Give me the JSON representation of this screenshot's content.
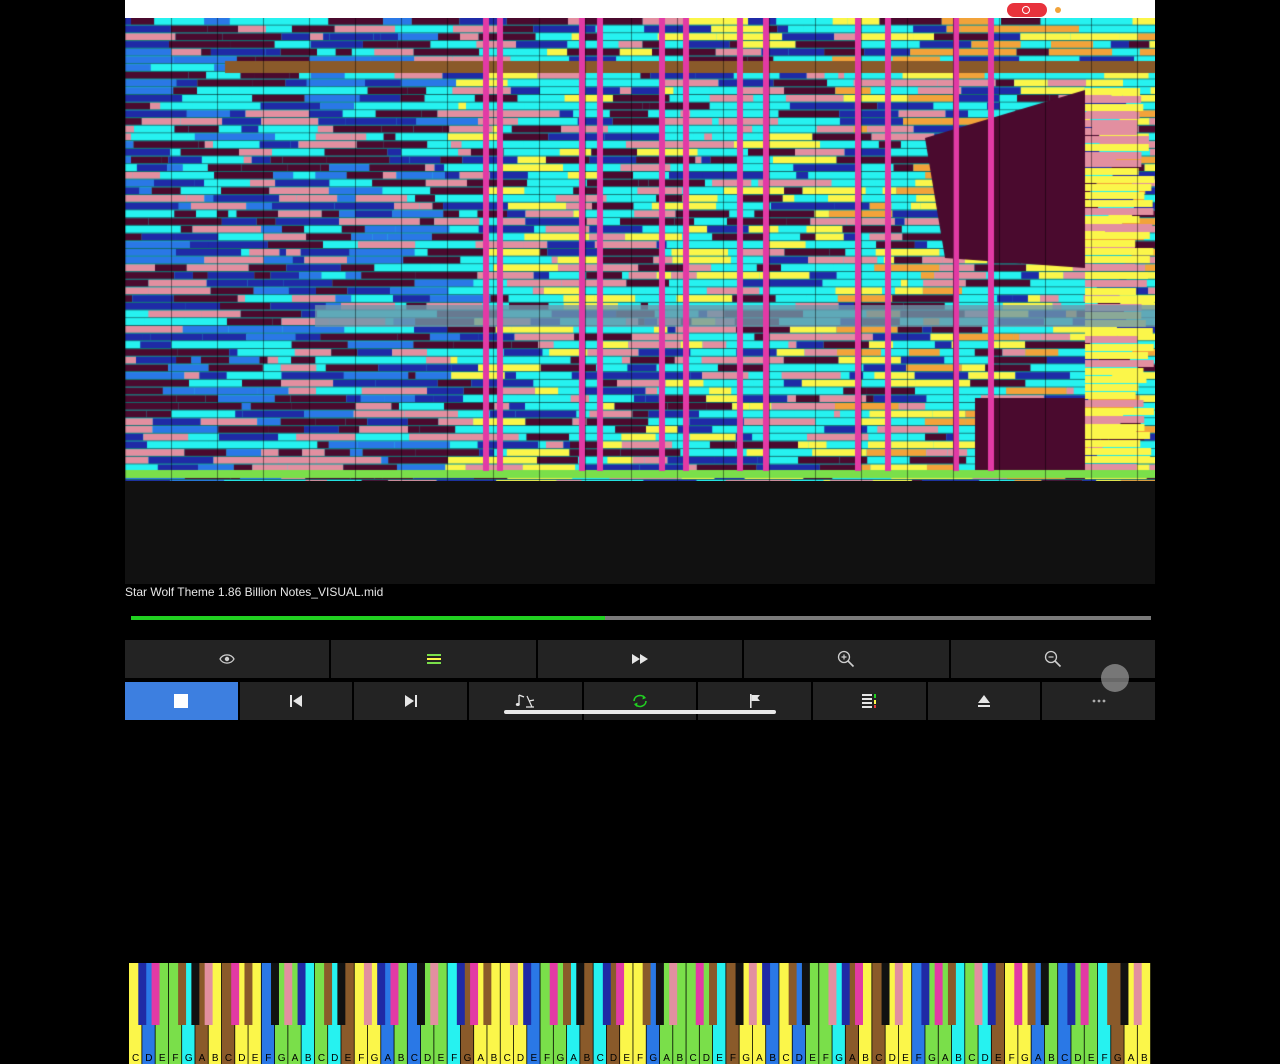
{
  "app": {
    "song_title": "Star Wolf Theme 1.86 Billion Notes_VISUAL.mid",
    "progress": 0.465
  },
  "colors": {
    "cyan": "#26f2f0",
    "navy": "#1f2aa6",
    "maroon": "#4a0a2e",
    "pink": "#e28fa0",
    "yellow": "#fbf64a",
    "magenta": "#e23aa5",
    "brown": "#8a5a2a",
    "blue": "#2a78e6",
    "green": "#7adf4a",
    "orange": "#f2a33a",
    "progress": "#21d121",
    "accent": "#3d7fe0"
  },
  "keyboard": {
    "octaves": 11,
    "labels": [
      "C",
      "D",
      "E",
      "F",
      "G",
      "A",
      "B"
    ]
  },
  "toolbar_top": [
    {
      "name": "view-eye-button",
      "icon": "eye-icon"
    },
    {
      "name": "equalizer-button",
      "icon": "equal-lines-icon"
    },
    {
      "name": "fast-forward-button",
      "icon": "fast-forward-icon"
    },
    {
      "name": "zoom-in-button",
      "icon": "zoom-in-icon"
    },
    {
      "name": "zoom-out-button",
      "icon": "zoom-out-icon"
    }
  ],
  "toolbar_bottom": [
    {
      "name": "stop-button",
      "icon": "stop-icon",
      "active": true
    },
    {
      "name": "previous-button",
      "icon": "skip-back-icon"
    },
    {
      "name": "next-button",
      "icon": "skip-forward-icon"
    },
    {
      "name": "metronome-button",
      "icon": "music-note-icon"
    },
    {
      "name": "loop-button",
      "icon": "loop-icon"
    },
    {
      "name": "marker-button",
      "icon": "flag-icon"
    },
    {
      "name": "tracks-button",
      "icon": "track-list-icon"
    },
    {
      "name": "eject-button",
      "icon": "eject-icon"
    },
    {
      "name": "more-button",
      "icon": "more-icon"
    }
  ]
}
